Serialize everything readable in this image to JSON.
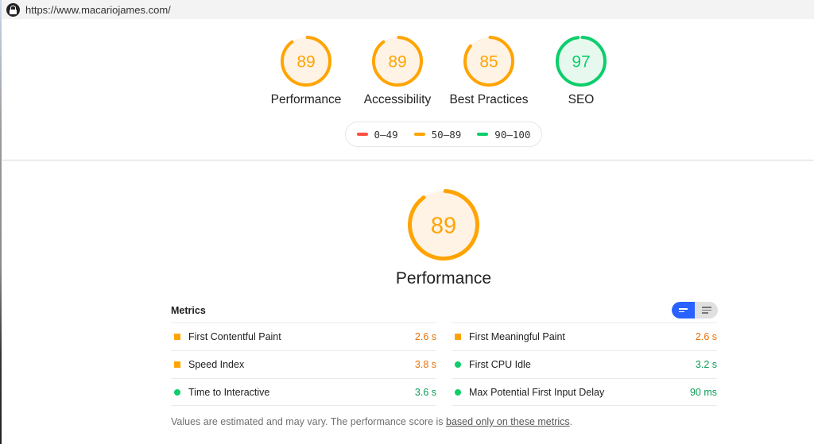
{
  "browser": {
    "url": "https://www.macariojames.com/"
  },
  "colors": {
    "fail": "#ff4e42",
    "average": "#ffa400",
    "pass": "#0cce6b",
    "average_bg": "#fff3e6",
    "pass_bg": "#e7f9ef"
  },
  "categories": [
    {
      "name": "Performance",
      "score": 89,
      "rating": "average"
    },
    {
      "name": "Accessibility",
      "score": 89,
      "rating": "average"
    },
    {
      "name": "Best Practices",
      "score": 85,
      "rating": "average"
    },
    {
      "name": "SEO",
      "score": 97,
      "rating": "pass"
    }
  ],
  "legend": [
    {
      "range": "0–49",
      "rating": "fail"
    },
    {
      "range": "50–89",
      "rating": "average"
    },
    {
      "range": "90–100",
      "rating": "pass"
    }
  ],
  "performance": {
    "title": "Performance",
    "score": 89,
    "metrics_title": "Metrics",
    "metrics_left": [
      {
        "name": "First Contentful Paint",
        "value": "2.6 s",
        "rating": "average"
      },
      {
        "name": "Speed Index",
        "value": "3.8 s",
        "rating": "average"
      },
      {
        "name": "Time to Interactive",
        "value": "3.6 s",
        "rating": "pass"
      }
    ],
    "metrics_right": [
      {
        "name": "First Meaningful Paint",
        "value": "2.6 s",
        "rating": "average"
      },
      {
        "name": "First CPU Idle",
        "value": "3.2 s",
        "rating": "pass"
      },
      {
        "name": "Max Potential First Input Delay",
        "value": "90 ms",
        "rating": "pass"
      }
    ],
    "footnote_prefix": "Values are estimated and may vary. The performance score is ",
    "footnote_link": "based only on these metrics",
    "footnote_suffix": "."
  }
}
